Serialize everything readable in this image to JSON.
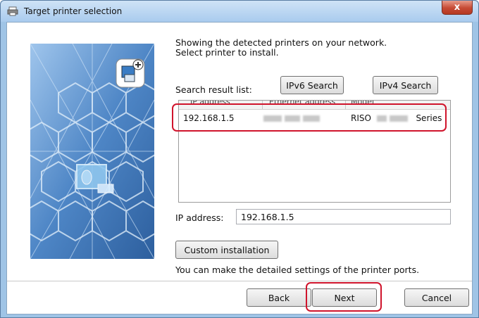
{
  "window": {
    "title": "Target printer selection",
    "close_label": "x"
  },
  "message": {
    "line1": "Showing the detected printers on your network.",
    "line2": "Select printer to install."
  },
  "search": {
    "label": "Search result list:",
    "ipv6_button": "IPv6 Search",
    "ipv4_button": "IPv4 Search"
  },
  "list": {
    "columns": [
      "IP address",
      "Ethernet address",
      "Model"
    ],
    "rows": [
      {
        "ip": "192.168.1.5",
        "model_prefix": "RISO",
        "model_suffix": "Series"
      }
    ]
  },
  "ip_field": {
    "label": "IP address:",
    "value": "192.168.1.5"
  },
  "custom": {
    "button": "Custom installation",
    "description": "You can make the detailed settings of the printer ports."
  },
  "footer": {
    "back": "Back",
    "next": "Next",
    "cancel": "Cancel"
  },
  "colors": {
    "highlight": "#d0142c",
    "art_blue": "#4f86c2",
    "titlebar": "#a9cbee"
  }
}
